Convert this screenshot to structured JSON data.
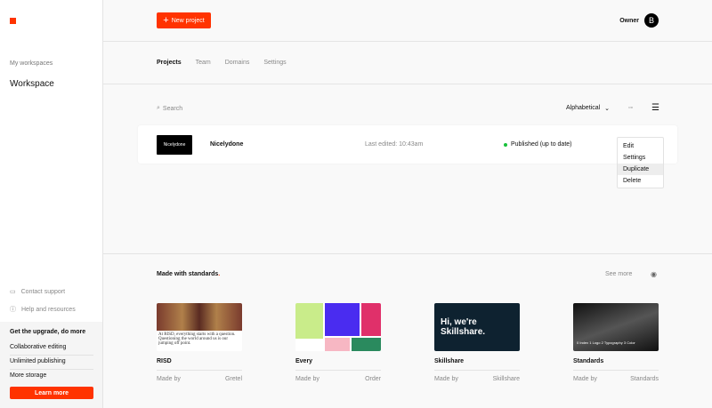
{
  "sidebar": {
    "my_workspaces": "My workspaces",
    "workspace": "Workspace",
    "contact": "Contact support",
    "help": "Help and resources",
    "upgrade": {
      "title": "Get the upgrade, do more",
      "items": [
        "Collaborative editing",
        "Unlimited publishing",
        "More storage"
      ],
      "button": "Learn more"
    }
  },
  "header": {
    "new_project": "New project",
    "owner": "Owner",
    "avatar": "B"
  },
  "tabs": [
    "Projects",
    "Team",
    "Domains",
    "Settings"
  ],
  "toolbar": {
    "search_placeholder": "Search",
    "sort": "Alphabetical"
  },
  "project": {
    "thumb": "Nicelydone",
    "name": "Nicelydone",
    "edited": "Last edited: 10:43am",
    "status": "Published (up to date)"
  },
  "menu": [
    "Edit",
    "Settings",
    "Duplicate",
    "Delete"
  ],
  "made": {
    "title": "Made with standards",
    "dot": ".",
    "see_more": "See more",
    "cards": [
      {
        "name": "RISD",
        "by_label": "Made by",
        "by": "Gretel",
        "preview": "At RISD, everything starts with a question. Questioning the world around us is our jumping off point."
      },
      {
        "name": "Every",
        "by_label": "Made by",
        "by": "Order"
      },
      {
        "name": "Skillshare",
        "by_label": "Made by",
        "by": "Skillshare",
        "preview": "Hi, we're Skillshare."
      },
      {
        "name": "Standards",
        "by_label": "Made by",
        "by": "Standards",
        "preview": "0 Index  1 Logo  2 Typography  3 Color"
      }
    ]
  },
  "colors": {
    "accent": "#ff3300",
    "published": "#18c13a"
  }
}
